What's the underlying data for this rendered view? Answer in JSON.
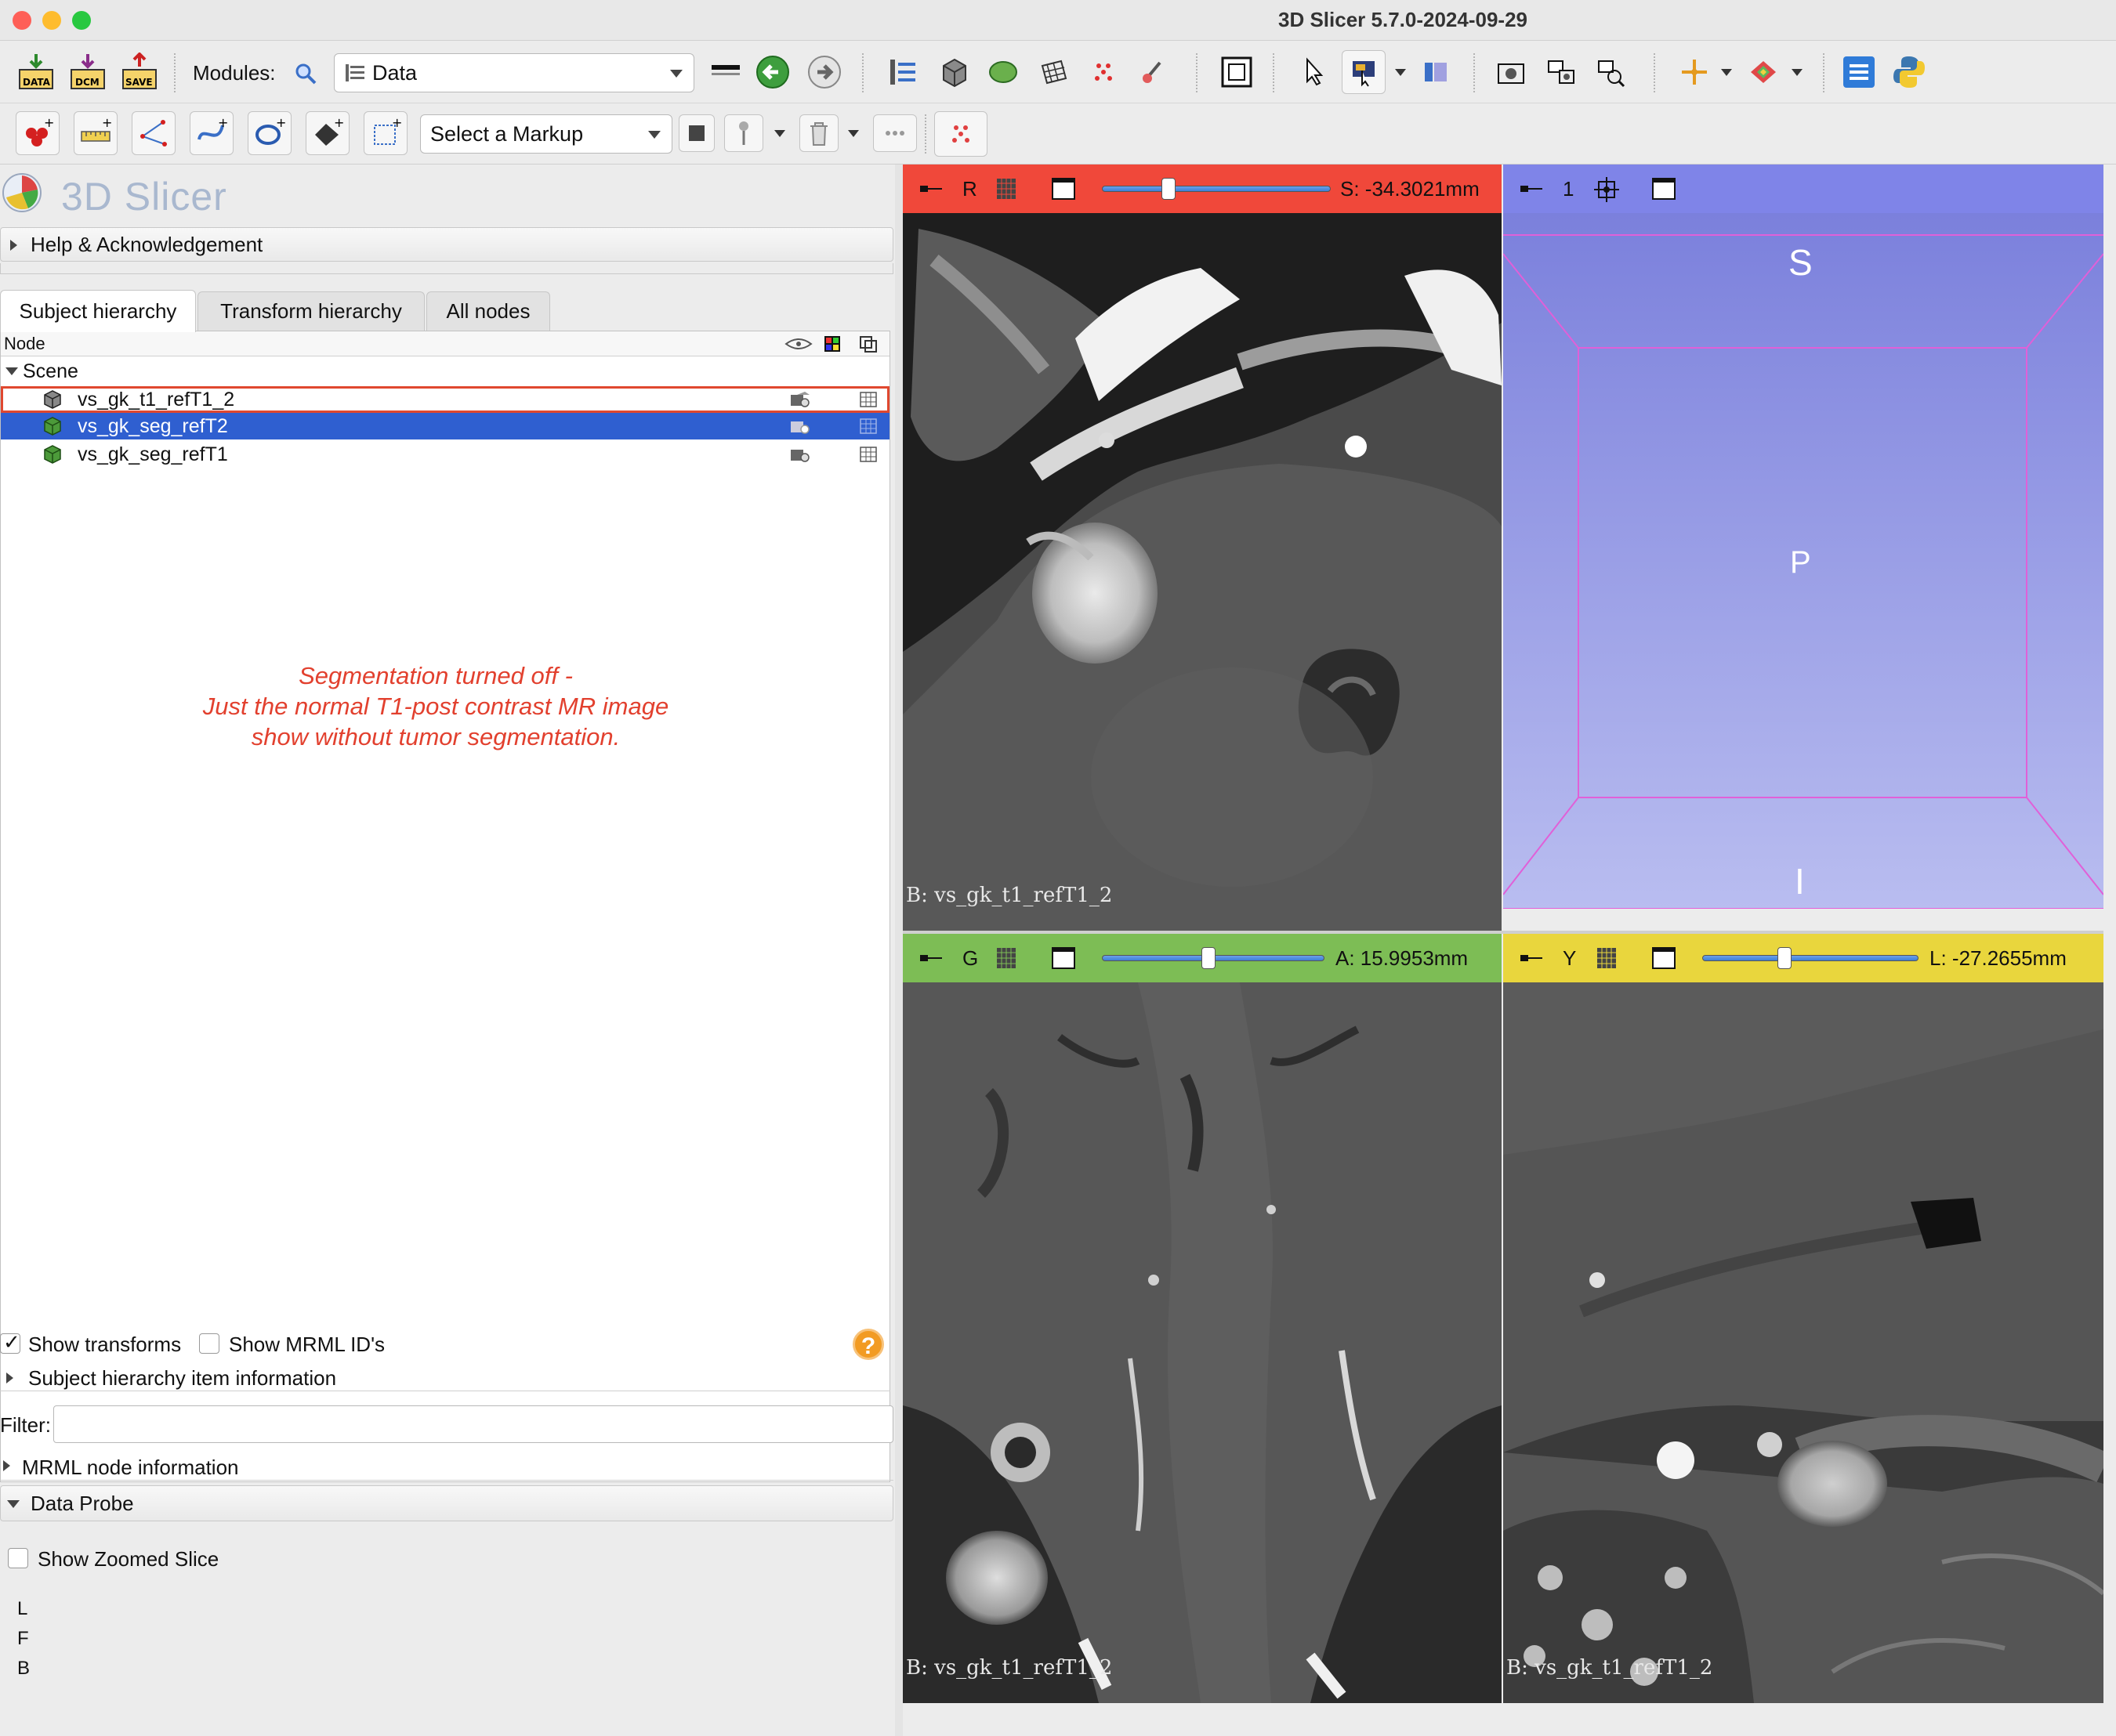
{
  "window": {
    "title": "3D Slicer 5.7.0-2024-09-29"
  },
  "toolbar1": {
    "modules_label": "Modules:",
    "module_selected": "Data",
    "btn_data_label": "DATA",
    "btn_dcm_label": "DCM",
    "btn_save_label": "SAVE"
  },
  "toolbar2": {
    "markup_selector": "Select a Markup"
  },
  "panel": {
    "logo_text": "3D Slicer",
    "help_section": "Help & Acknowledgement",
    "tabs": [
      {
        "label": "Subject hierarchy"
      },
      {
        "label": "Transform hierarchy"
      },
      {
        "label": "All nodes"
      }
    ],
    "tree_header": "Node",
    "tree": {
      "root": "Scene",
      "items": [
        {
          "label": "vs_gk_t1_refT1_2"
        },
        {
          "label": "vs_gk_seg_refT2"
        },
        {
          "label": "vs_gk_seg_refT1"
        }
      ]
    },
    "annotation": {
      "line1": "Segmentation turned off -",
      "line2": "Just the normal T1-post contrast MR image",
      "line3": "show without tumor segmentation."
    },
    "show_transforms": "Show transforms",
    "show_mrml_ids": "Show MRML ID's",
    "sh_item_info": "Subject hierarchy item information",
    "filter_label": "Filter:",
    "filter_value": "",
    "mrml_node_info": "MRML node information",
    "data_probe": "Data Probe",
    "show_zoomed_slice": "Show Zoomed Slice",
    "probe_lines": [
      "L",
      "F",
      "B"
    ]
  },
  "viewers": {
    "red": {
      "label": "R",
      "offset": "S: -34.3021mm",
      "slider_fraction": 0.29,
      "caption": "B: vs_gk_t1_refT1_2",
      "color": "#f0483a"
    },
    "threed": {
      "label": "1",
      "color": "#7f84e8",
      "orient_top": "S",
      "orient_center": "P",
      "orient_bottom": "I"
    },
    "green": {
      "label": "G",
      "offset": "A: 15.9953mm",
      "slider_fraction": 0.48,
      "caption": "B: vs_gk_t1_refT1_2",
      "color": "#7dbd55"
    },
    "yellow": {
      "label": "Y",
      "offset": "L: -27.2655mm",
      "slider_fraction": 0.38,
      "caption": "B: vs_gk_t1_refT1_2",
      "color": "#e9d63d"
    }
  }
}
